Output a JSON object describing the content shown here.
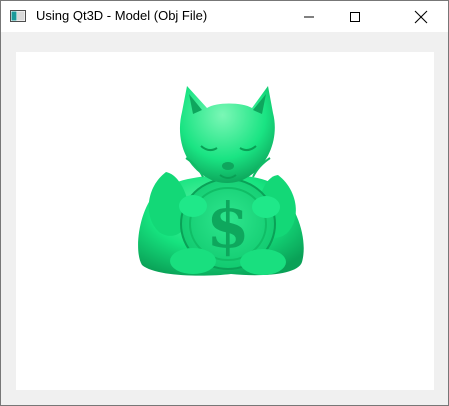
{
  "window": {
    "title": "Using Qt3D - Model (Obj File)"
  },
  "icons": {
    "app": "qt-window-icon",
    "minimize": "minimize-icon",
    "maximize": "maximize-icon",
    "close": "close-icon"
  },
  "colors": {
    "titlebar": "#ffffff",
    "frame": "#f0f0f0",
    "viewport": "#ffffff",
    "model_primary": "#16e37f",
    "model_shadow": "#0aa157",
    "model_highlight": "#8bf7c0"
  },
  "viewport": {
    "model": "green cat holding dollar coin"
  }
}
